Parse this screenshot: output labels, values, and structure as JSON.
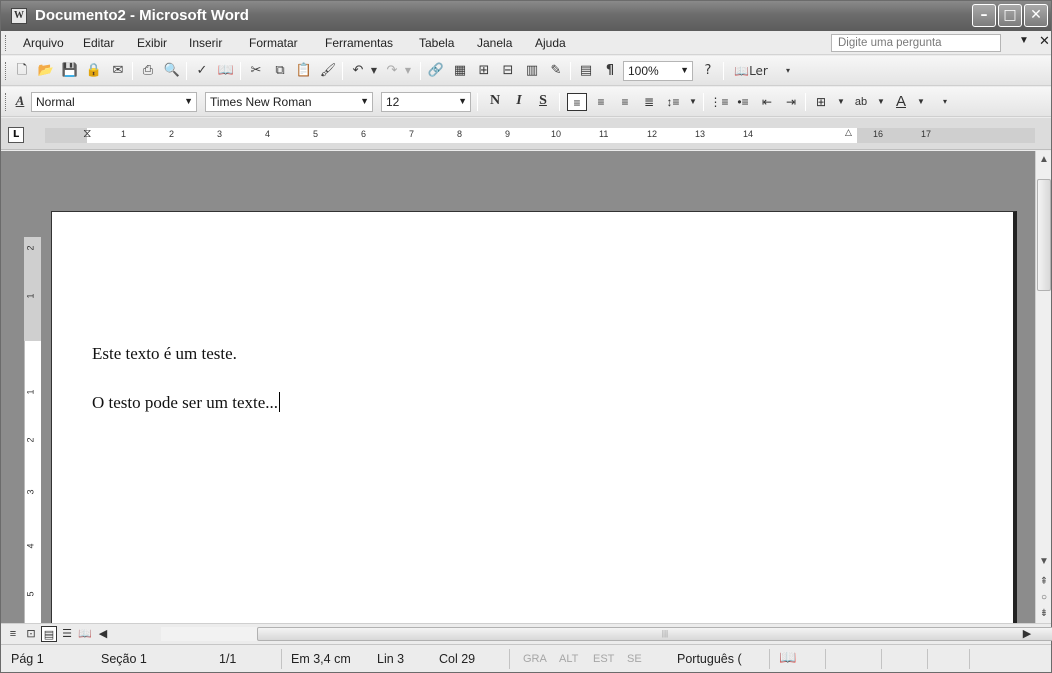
{
  "window": {
    "title": "Documento2 - Microsoft Word",
    "icon": "word-doc-icon"
  },
  "menu": {
    "items": [
      "Arquivo",
      "Editar",
      "Exibir",
      "Inserir",
      "Formatar",
      "Ferramentas",
      "Tabela",
      "Janela",
      "Ajuda"
    ],
    "ask_placeholder": "Digite uma pergunta"
  },
  "standard_toolbar": {
    "zoom": "100%",
    "read_label": "Ler"
  },
  "formatting_toolbar": {
    "style": "Normal",
    "font": "Times New Roman",
    "size": "12",
    "bold": "N",
    "italic": "I",
    "underline": "S",
    "style_icon": "A"
  },
  "ruler": {
    "marks": [
      "1",
      "2",
      "3",
      "4",
      "5",
      "6",
      "7",
      "8",
      "9",
      "10",
      "11",
      "12",
      "13",
      "14",
      "16",
      "17"
    ]
  },
  "vertical_ruler": {
    "marks": [
      "2",
      "1",
      "1",
      "2",
      "3",
      "4",
      "5"
    ]
  },
  "document": {
    "lines": [
      "Este texto é um teste.",
      "O testo pode ser um texte..."
    ]
  },
  "status": {
    "page": "Pág 1",
    "section": "Seção 1",
    "pages": "1/1",
    "at": "Em 3,4 cm",
    "line": "Lin 3",
    "col": "Col 29",
    "rec": "GRA",
    "trk": "ALT",
    "ext": "EST",
    "ovr": "SE",
    "language": "Português ("
  }
}
